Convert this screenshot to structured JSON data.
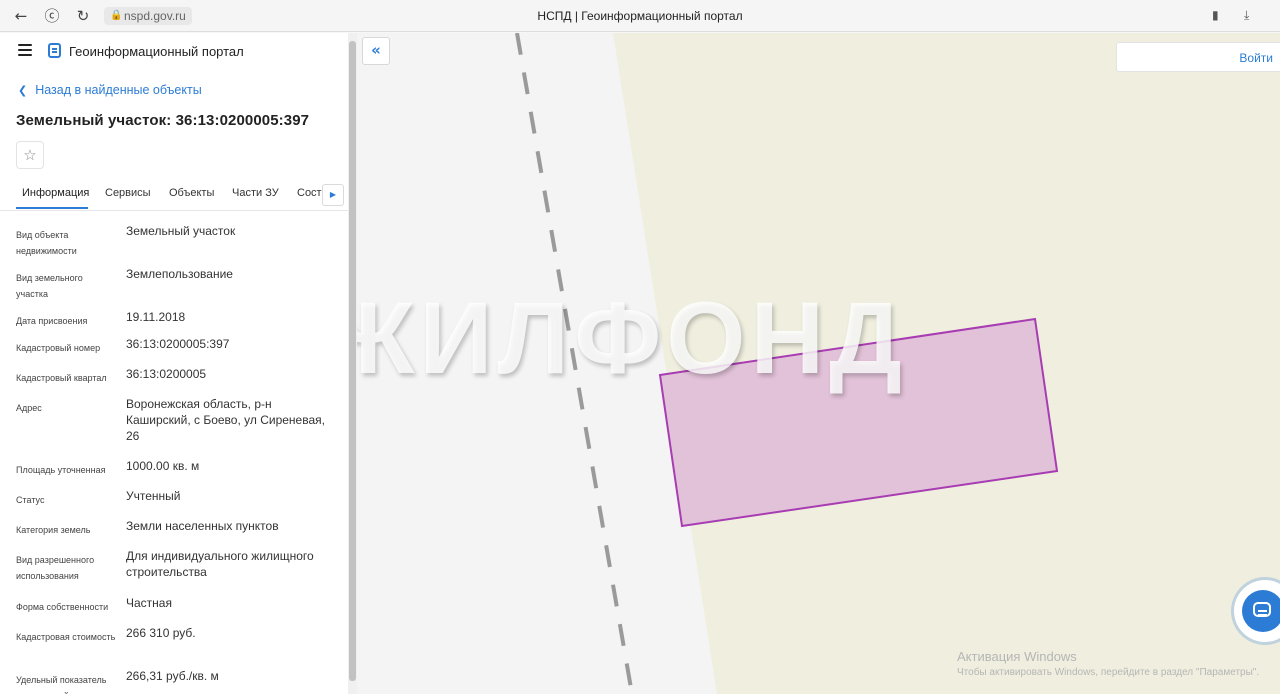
{
  "browser": {
    "back_icon": "back-arrow-icon",
    "yandex_icon": "yandex-icon",
    "reload_icon": "reload-icon",
    "url": "nspd.gov.ru",
    "page_title": "НСПД | Геоинформационный портал",
    "bookmark_icon": "bookmark-icon",
    "download_icon": "download-icon"
  },
  "header": {
    "portal_name": "Геоинформационный портал"
  },
  "panel": {
    "back_link": "Назад в найденные объекты",
    "title": "Земельный участок: 36:13:0200005:397",
    "tabs": [
      {
        "label": "Информация"
      },
      {
        "label": "Сервисы"
      },
      {
        "label": "Объекты"
      },
      {
        "label": "Части ЗУ"
      },
      {
        "label": "Соста"
      }
    ],
    "rows": [
      {
        "label": "Вид объекта недвижимости",
        "value": "Земельный участок"
      },
      {
        "label": "Вид земельного участка",
        "value": "Землепользование"
      },
      {
        "label": "Дата присвоения",
        "value": "19.11.2018"
      },
      {
        "label": "Кадастровый номер",
        "value": "36:13:0200005:397"
      },
      {
        "label": "Кадастровый квартал",
        "value": "36:13:0200005"
      },
      {
        "label": "Адрес",
        "value": "Воронежская область, р-н Каширский, с Боево, ул Сиреневая, 26"
      },
      {
        "label": "Площадь уточненная",
        "value": "1000.00 кв. м"
      },
      {
        "label": "Статус",
        "value": "Учтенный"
      },
      {
        "label": "Категория земель",
        "value": "Земли населенных пунктов"
      },
      {
        "label": "Вид разрешенного использования",
        "value": "Для индивидуального жилищного строительства"
      },
      {
        "label": "Форма собственности",
        "value": "Частная"
      },
      {
        "label": "Кадастровая стоимость",
        "value": "266 310 руб."
      },
      {
        "label": "Удельный показатель кадастровой",
        "value": "266,31 руб./кв. м"
      }
    ]
  },
  "map": {
    "login_label": "Войти",
    "watermark": "ЖИЛФОНД",
    "windows_activation_title": "Активация Windows",
    "windows_activation_text": "Чтобы активировать Windows, перейдите в раздел \"Параметры\".",
    "colors": {
      "land": "#f0efdf",
      "road": "#f4f4f4",
      "parcel_fill": "#e2c2d8",
      "parcel_stroke": "#a83cb3",
      "accent": "#2c7cd6"
    }
  }
}
